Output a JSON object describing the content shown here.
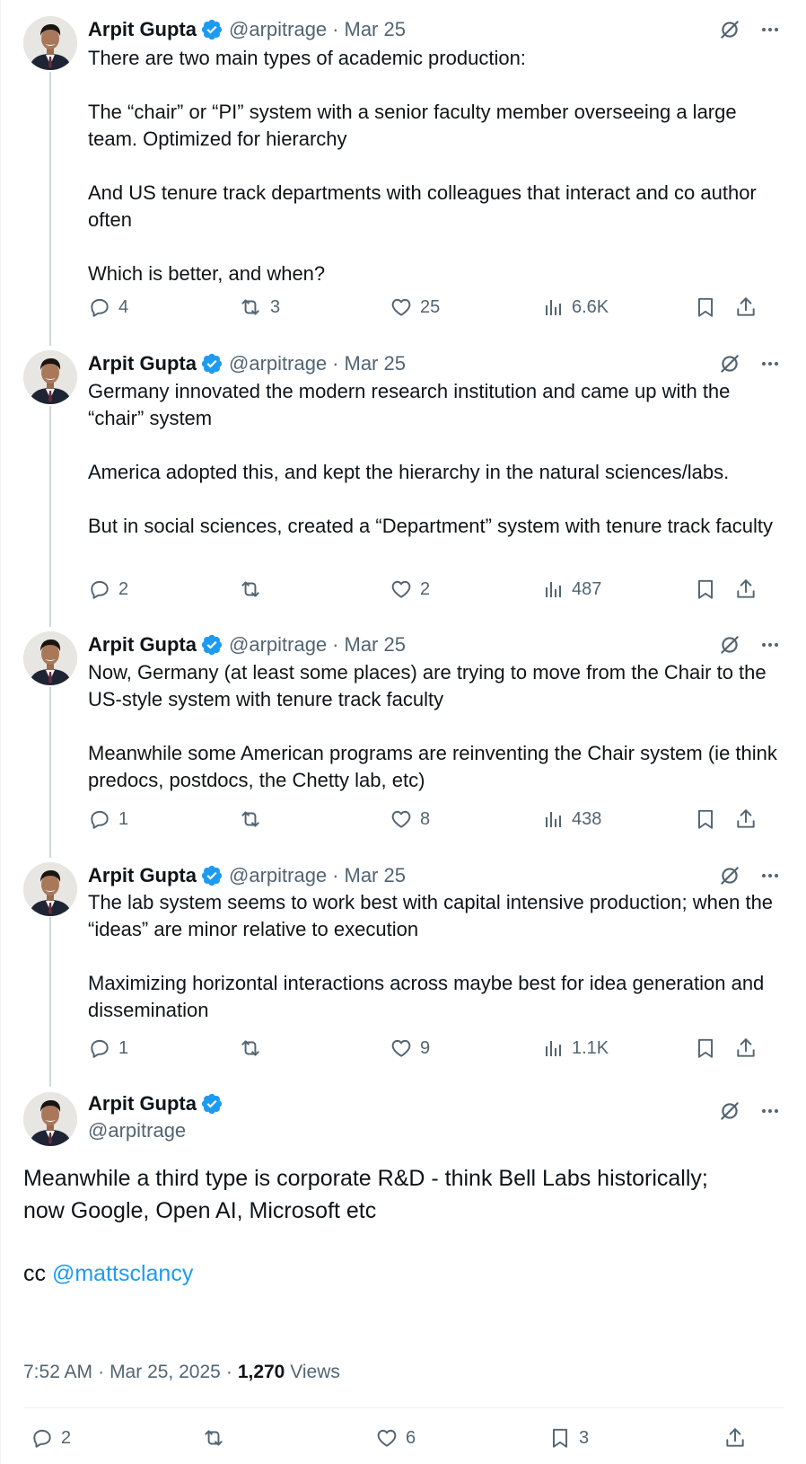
{
  "author": {
    "name": "Arpit Gupta",
    "handle": "@arpitrage"
  },
  "thread": [
    {
      "date": "Mar 25",
      "text": "There are two main types of academic production:\n\nThe “chair” or “PI” system with a senior faculty member overseeing a large team. Optimized for hierarchy\n\nAnd US tenure track departments with colleagues that interact and co author often\n\nWhich is better, and when?",
      "replies": "4",
      "reposts": "3",
      "likes": "25",
      "views": "6.6K"
    },
    {
      "date": "Mar 25",
      "text": "Germany innovated the modern research institution and came up with the “chair” system\n\nAmerica adopted this, and kept the hierarchy in the natural sciences/labs.\n\nBut in social sciences, created a “Department” system with tenure track faculty",
      "replies": "2",
      "reposts": "",
      "likes": "2",
      "views": "487"
    },
    {
      "date": "Mar 25",
      "text": "Now, Germany (at least some places) are trying to move from the Chair to the US-style system with tenure track faculty\n\nMeanwhile some American programs are reinventing the Chair system (ie think predocs, postdocs, the Chetty lab, etc)",
      "replies": "1",
      "reposts": "",
      "likes": "8",
      "views": "438"
    },
    {
      "date": "Mar 25",
      "text": "The lab system seems to work best with capital intensive production; when the “ideas” are minor relative to execution\n\nMaximizing horizontal interactions across maybe best for idea generation and dissemination",
      "replies": "1",
      "reposts": "",
      "likes": "9",
      "views": "1.1K"
    }
  ],
  "main": {
    "text_line1": "Meanwhile a third type is corporate R&D - think Bell Labs historically;",
    "text_line2": "now Google, Open AI, Microsoft etc",
    "cc_label": "cc",
    "mention": "@mattsclancy",
    "time": "7:52 AM",
    "date": "Mar 25, 2025",
    "views_count": "1,270",
    "views_label": "Views",
    "replies": "2",
    "reposts": "",
    "likes": "6",
    "bookmarks": "3"
  },
  "separator": "·",
  "icons": {
    "reply": "reply-icon",
    "repost": "repost-icon",
    "like": "heart-icon",
    "views": "views-chart-icon",
    "bookmark": "bookmark-icon",
    "share": "share-icon",
    "grok": "grok-icon",
    "more": "more-icon",
    "verified": "verified-badge-icon"
  },
  "colors": {
    "accent": "#1d9bf0",
    "text": "#0f1419",
    "secondary": "#536471",
    "thread_line": "#cfd9de"
  }
}
